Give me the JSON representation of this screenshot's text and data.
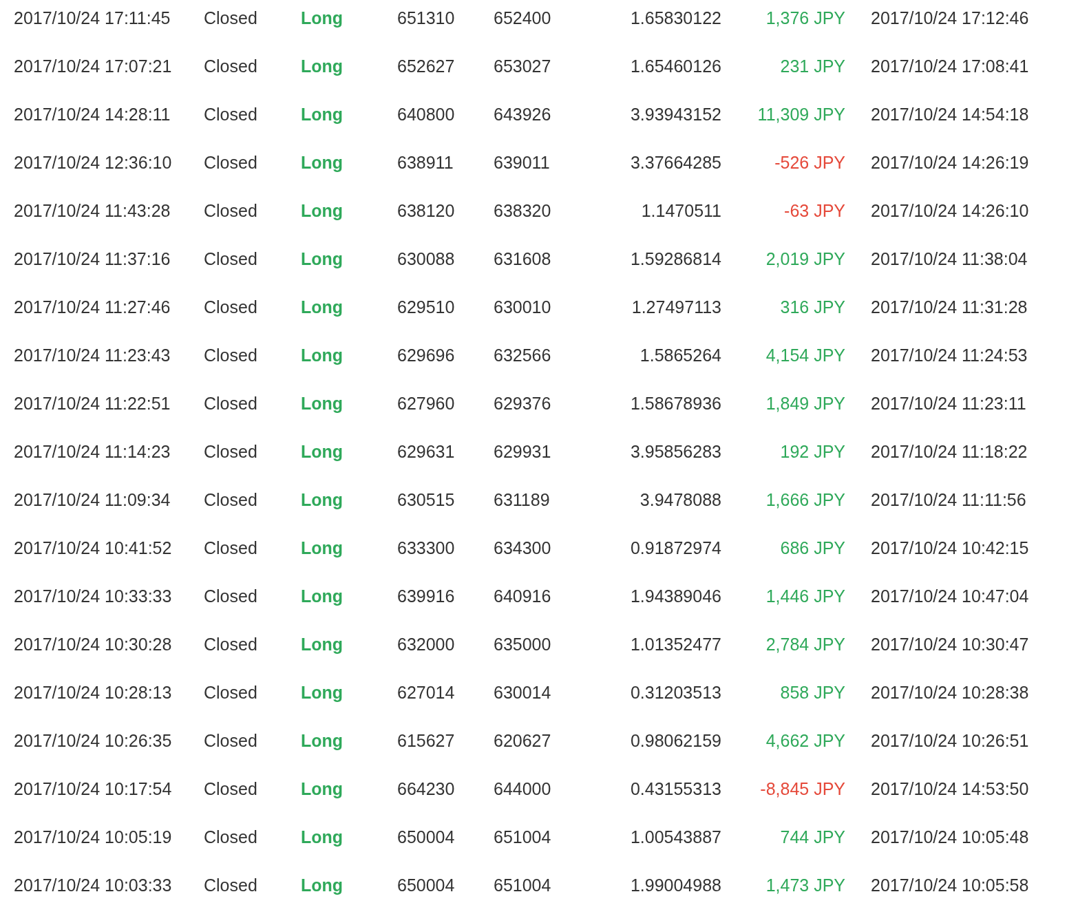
{
  "rows": [
    {
      "opened": "2017/10/24 17:11:45",
      "status": "Closed",
      "side": "Long",
      "entry": "651310",
      "exit": "652400",
      "amount": "1.65830122",
      "profit": "1,376 JPY",
      "loss": false,
      "closed": "2017/10/24 17:12:46"
    },
    {
      "opened": "2017/10/24 17:07:21",
      "status": "Closed",
      "side": "Long",
      "entry": "652627",
      "exit": "653027",
      "amount": "1.65460126",
      "profit": "231 JPY",
      "loss": false,
      "closed": "2017/10/24 17:08:41"
    },
    {
      "opened": "2017/10/24 14:28:11",
      "status": "Closed",
      "side": "Long",
      "entry": "640800",
      "exit": "643926",
      "amount": "3.93943152",
      "profit": "11,309 JPY",
      "loss": false,
      "closed": "2017/10/24 14:54:18"
    },
    {
      "opened": "2017/10/24 12:36:10",
      "status": "Closed",
      "side": "Long",
      "entry": "638911",
      "exit": "639011",
      "amount": "3.37664285",
      "profit": "-526 JPY",
      "loss": true,
      "closed": "2017/10/24 14:26:19"
    },
    {
      "opened": "2017/10/24 11:43:28",
      "status": "Closed",
      "side": "Long",
      "entry": "638120",
      "exit": "638320",
      "amount": "1.1470511",
      "profit": "-63 JPY",
      "loss": true,
      "closed": "2017/10/24 14:26:10"
    },
    {
      "opened": "2017/10/24 11:37:16",
      "status": "Closed",
      "side": "Long",
      "entry": "630088",
      "exit": "631608",
      "amount": "1.59286814",
      "profit": "2,019 JPY",
      "loss": false,
      "closed": "2017/10/24 11:38:04"
    },
    {
      "opened": "2017/10/24 11:27:46",
      "status": "Closed",
      "side": "Long",
      "entry": "629510",
      "exit": "630010",
      "amount": "1.27497113",
      "profit": "316 JPY",
      "loss": false,
      "closed": "2017/10/24 11:31:28"
    },
    {
      "opened": "2017/10/24 11:23:43",
      "status": "Closed",
      "side": "Long",
      "entry": "629696",
      "exit": "632566",
      "amount": "1.5865264",
      "profit": "4,154 JPY",
      "loss": false,
      "closed": "2017/10/24 11:24:53"
    },
    {
      "opened": "2017/10/24 11:22:51",
      "status": "Closed",
      "side": "Long",
      "entry": "627960",
      "exit": "629376",
      "amount": "1.58678936",
      "profit": "1,849 JPY",
      "loss": false,
      "closed": "2017/10/24 11:23:11"
    },
    {
      "opened": "2017/10/24 11:14:23",
      "status": "Closed",
      "side": "Long",
      "entry": "629631",
      "exit": "629931",
      "amount": "3.95856283",
      "profit": "192 JPY",
      "loss": false,
      "closed": "2017/10/24 11:18:22"
    },
    {
      "opened": "2017/10/24 11:09:34",
      "status": "Closed",
      "side": "Long",
      "entry": "630515",
      "exit": "631189",
      "amount": "3.9478088",
      "profit": "1,666 JPY",
      "loss": false,
      "closed": "2017/10/24 11:11:56"
    },
    {
      "opened": "2017/10/24 10:41:52",
      "status": "Closed",
      "side": "Long",
      "entry": "633300",
      "exit": "634300",
      "amount": "0.91872974",
      "profit": "686 JPY",
      "loss": false,
      "closed": "2017/10/24 10:42:15"
    },
    {
      "opened": "2017/10/24 10:33:33",
      "status": "Closed",
      "side": "Long",
      "entry": "639916",
      "exit": "640916",
      "amount": "1.94389046",
      "profit": "1,446 JPY",
      "loss": false,
      "closed": "2017/10/24 10:47:04"
    },
    {
      "opened": "2017/10/24 10:30:28",
      "status": "Closed",
      "side": "Long",
      "entry": "632000",
      "exit": "635000",
      "amount": "1.01352477",
      "profit": "2,784 JPY",
      "loss": false,
      "closed": "2017/10/24 10:30:47"
    },
    {
      "opened": "2017/10/24 10:28:13",
      "status": "Closed",
      "side": "Long",
      "entry": "627014",
      "exit": "630014",
      "amount": "0.31203513",
      "profit": "858 JPY",
      "loss": false,
      "closed": "2017/10/24 10:28:38"
    },
    {
      "opened": "2017/10/24 10:26:35",
      "status": "Closed",
      "side": "Long",
      "entry": "615627",
      "exit": "620627",
      "amount": "0.98062159",
      "profit": "4,662 JPY",
      "loss": false,
      "closed": "2017/10/24 10:26:51"
    },
    {
      "opened": "2017/10/24 10:17:54",
      "status": "Closed",
      "side": "Long",
      "entry": "664230",
      "exit": "644000",
      "amount": "0.43155313",
      "profit": "-8,845 JPY",
      "loss": true,
      "closed": "2017/10/24 14:53:50"
    },
    {
      "opened": "2017/10/24 10:05:19",
      "status": "Closed",
      "side": "Long",
      "entry": "650004",
      "exit": "651004",
      "amount": "1.00543887",
      "profit": "744 JPY",
      "loss": false,
      "closed": "2017/10/24 10:05:48"
    },
    {
      "opened": "2017/10/24 10:03:33",
      "status": "Closed",
      "side": "Long",
      "entry": "650004",
      "exit": "651004",
      "amount": "1.99004988",
      "profit": "1,473 JPY",
      "loss": false,
      "closed": "2017/10/24 10:05:58"
    }
  ]
}
